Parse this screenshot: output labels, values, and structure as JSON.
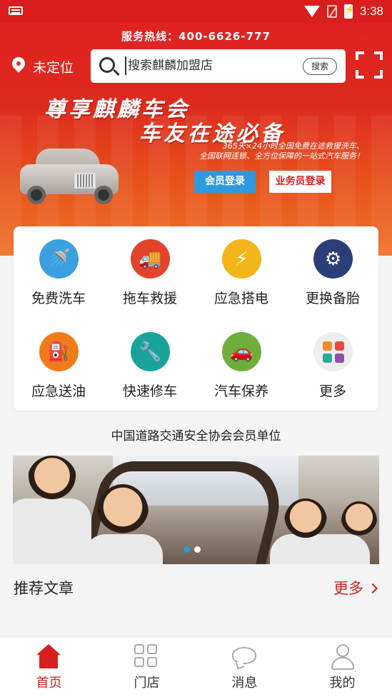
{
  "status_bar": {
    "time": "3:38"
  },
  "header": {
    "hotline": "服务热线：400-6626-777",
    "location": "未定位",
    "search_placeholder": "搜索麒麟加盟店",
    "search_button": "搜索"
  },
  "banner": {
    "slogan_line1": "尊享麒麟车会",
    "slogan_line2": "车友在途必备",
    "sub_line1": "365天×24小时全国免费在途救援洗车、",
    "sub_line2": "全国联网连锁、全方位保障的一站式汽车服务！",
    "member_login": "会员登录",
    "staff_login": "业务员登录"
  },
  "services": [
    {
      "label": "免费洗车",
      "icon": "car-wash-icon",
      "color": "#3aa0e0"
    },
    {
      "label": "拖车救援",
      "icon": "tow-truck-icon",
      "color": "#e2432a"
    },
    {
      "label": "应急搭电",
      "icon": "battery-icon",
      "color": "#f2b61a"
    },
    {
      "label": "更换备胎",
      "icon": "tire-change-icon",
      "color": "#2c3e7a"
    },
    {
      "label": "应急送油",
      "icon": "fuel-icon",
      "color": "#f07b18"
    },
    {
      "label": "快速修车",
      "icon": "repair-icon",
      "color": "#1aa39a"
    },
    {
      "label": "汽车保养",
      "icon": "maintenance-icon",
      "color": "#6fae3a"
    },
    {
      "label": "更多",
      "icon": "more-grid-icon",
      "color": "#eeeeee"
    }
  ],
  "association": "中国道路交通安全协会会员单位",
  "articles": {
    "title": "推荐文章",
    "more": "更多"
  },
  "bottom_nav": [
    {
      "label": "首页",
      "active": true
    },
    {
      "label": "门店",
      "active": false
    },
    {
      "label": "消息",
      "active": false
    },
    {
      "label": "我的",
      "active": false
    }
  ],
  "colors": {
    "brand_red": "#d81e1e",
    "accent_blue": "#2d9ae0"
  }
}
